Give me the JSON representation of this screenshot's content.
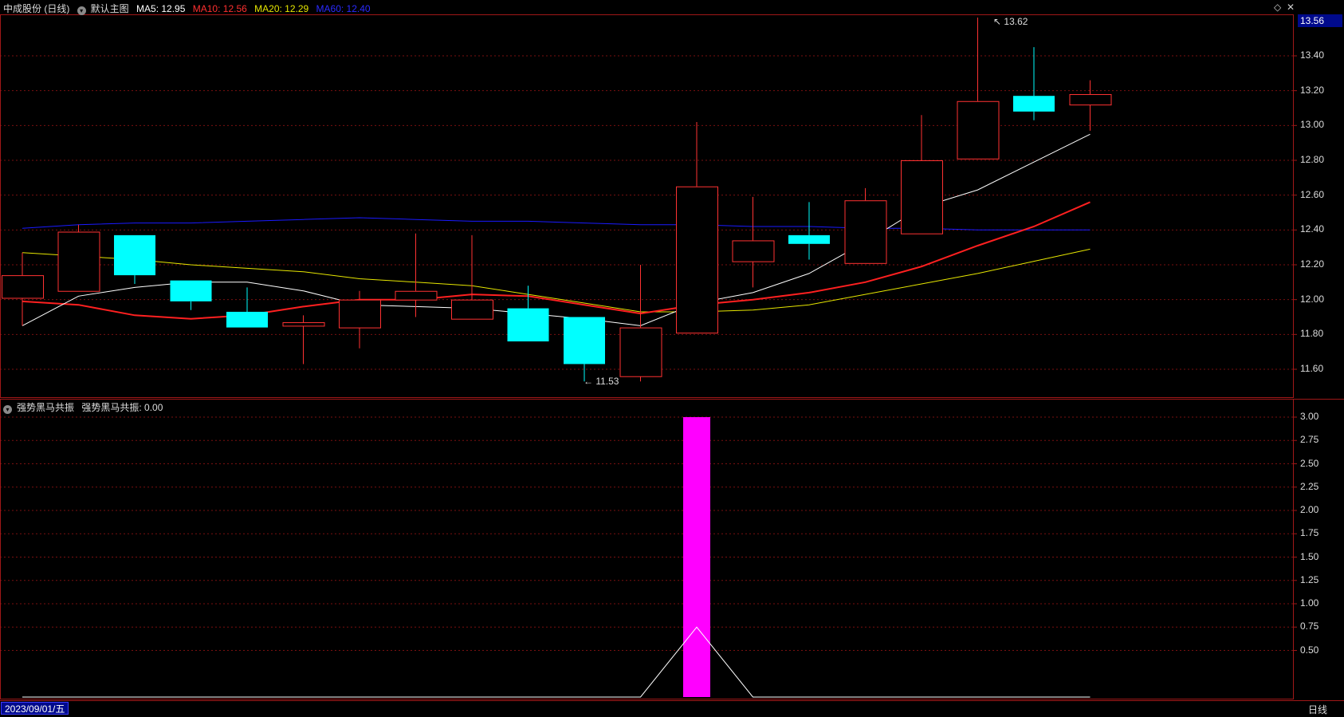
{
  "header": {
    "stock": "中成股份 (日线)",
    "template_label": "默认主图",
    "ma5": "MA5: 12.95",
    "ma10": "MA10: 12.56",
    "ma20": "MA20: 12.29",
    "ma60": "MA60: 12.40",
    "colors": {
      "ma5": "#ffffff",
      "ma10": "#ff2020",
      "ma20": "#e6e600",
      "ma60": "#1a1aff"
    }
  },
  "indicator": {
    "title": "强势黑马共振",
    "value_label": "强势黑马共振: 0.00"
  },
  "price_axis": {
    "current_price": "13.56",
    "ticks": [
      "13.40",
      "13.20",
      "13.00",
      "12.80",
      "12.60",
      "12.40",
      "12.20",
      "12.00",
      "11.80",
      "11.60"
    ]
  },
  "indicator_axis": {
    "ticks": [
      "3.00",
      "2.75",
      "2.50",
      "2.25",
      "2.00",
      "1.75",
      "1.50",
      "1.25",
      "1.00",
      "0.75",
      "0.50"
    ]
  },
  "annotations": {
    "high": "13.62",
    "low": "11.53"
  },
  "footer": {
    "date": "2023/09/01/五",
    "period": "日线"
  },
  "chart_data": {
    "type": "candlestick",
    "candles": [
      {
        "o": 12.01,
        "c": 12.14,
        "h": 12.27,
        "l": 11.85
      },
      {
        "o": 12.05,
        "c": 12.39,
        "h": 12.43,
        "l": 12.05
      },
      {
        "o": 12.37,
        "c": 12.14,
        "h": 12.37,
        "l": 12.09
      },
      {
        "o": 12.11,
        "c": 11.99,
        "h": 12.11,
        "l": 11.94
      },
      {
        "o": 11.93,
        "c": 11.84,
        "h": 12.07,
        "l": 11.84
      },
      {
        "o": 11.85,
        "c": 11.87,
        "h": 11.91,
        "l": 11.63
      },
      {
        "o": 11.84,
        "c": 12.0,
        "h": 12.05,
        "l": 11.72
      },
      {
        "o": 12.0,
        "c": 12.05,
        "h": 12.38,
        "l": 11.9
      },
      {
        "o": 11.89,
        "c": 12.0,
        "h": 12.37,
        "l": 11.89
      },
      {
        "o": 11.95,
        "c": 11.76,
        "h": 12.08,
        "l": 11.76
      },
      {
        "o": 11.9,
        "c": 11.63,
        "h": 11.9,
        "l": 11.53
      },
      {
        "o": 11.56,
        "c": 11.84,
        "h": 12.2,
        "l": 11.53
      },
      {
        "o": 11.81,
        "c": 12.65,
        "h": 13.02,
        "l": 11.81
      },
      {
        "o": 12.22,
        "c": 12.34,
        "h": 12.59,
        "l": 12.07
      },
      {
        "o": 12.37,
        "c": 12.32,
        "h": 12.56,
        "l": 12.23
      },
      {
        "o": 12.21,
        "c": 12.57,
        "h": 12.64,
        "l": 12.21
      },
      {
        "o": 12.38,
        "c": 12.8,
        "h": 13.06,
        "l": 12.38
      },
      {
        "o": 12.81,
        "c": 13.14,
        "h": 13.62,
        "l": 12.81
      },
      {
        "o": 13.17,
        "c": 13.08,
        "h": 13.45,
        "l": 13.03
      },
      {
        "o": 13.12,
        "c": 13.18,
        "h": 13.26,
        "l": 12.97
      }
    ],
    "ma5": [
      11.85,
      12.02,
      12.07,
      12.1,
      12.1,
      12.05,
      11.97,
      11.96,
      11.95,
      11.92,
      11.89,
      11.85,
      11.98,
      12.04,
      12.15,
      12.33,
      12.53,
      12.63,
      12.79,
      12.95
    ],
    "ma10": [
      11.99,
      11.97,
      11.91,
      11.89,
      11.91,
      11.96,
      12.0,
      12.0,
      12.03,
      12.02,
      11.97,
      11.92,
      11.97,
      12.0,
      12.04,
      12.1,
      12.19,
      12.31,
      12.42,
      12.56
    ],
    "ma20": [
      12.27,
      12.25,
      12.23,
      12.2,
      12.18,
      12.16,
      12.12,
      12.1,
      12.08,
      12.03,
      11.98,
      11.93,
      11.93,
      11.94,
      11.97,
      12.03,
      12.09,
      12.15,
      12.22,
      12.29
    ],
    "ma60": [
      12.41,
      12.43,
      12.44,
      12.44,
      12.45,
      12.46,
      12.47,
      12.46,
      12.45,
      12.45,
      12.44,
      12.43,
      12.43,
      12.42,
      12.42,
      12.41,
      12.41,
      12.4,
      12.4,
      12.4
    ],
    "price_range": [
      11.43,
      13.7
    ],
    "indicator": {
      "bar_index": 12,
      "bar_value": 3.0,
      "line": [
        0,
        0,
        0,
        0,
        0,
        0,
        0,
        0,
        0,
        0,
        0,
        0,
        0.75,
        0,
        0,
        0,
        0,
        0,
        0,
        0
      ]
    },
    "indicator_range": [
      0,
      3.05
    ],
    "up_color": "#ff3232",
    "down_color": "#00ffff",
    "indicator_color": "#ff00ff"
  }
}
